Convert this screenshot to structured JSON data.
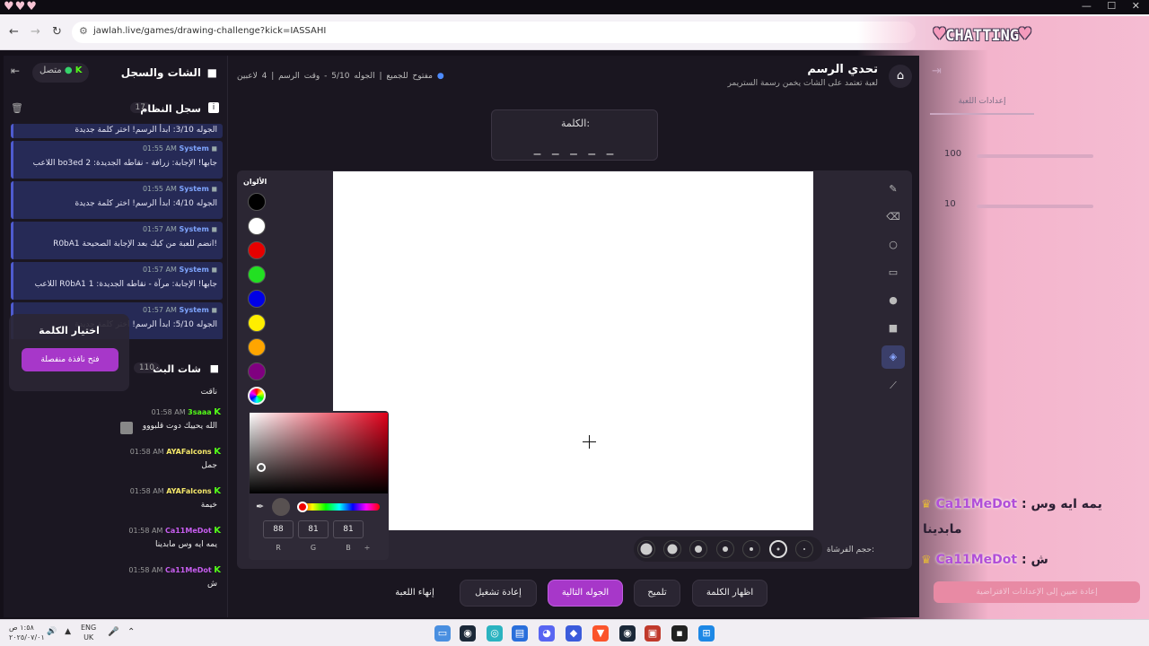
{
  "browser": {
    "url": "jawlah.live/games/drawing-challenge?kick=IASSAHI",
    "overlay_title": "CHATTING"
  },
  "left_panel": {
    "title": "الشات والسجل",
    "status": "متصل",
    "system_log": {
      "title": "سجل النظام",
      "count": "17",
      "entries": [
        {
          "time": "",
          "source": "",
          "text": "الجوله 3/10: ابدأ الرسم! اختر كلمة جديدة"
        },
        {
          "time": "01:55 AM",
          "source": "System",
          "text": "اللاعب bo3ed جابها! الإجابة: زرافة - نقاطه الجديدة: 2"
        },
        {
          "time": "01:55 AM",
          "source": "System",
          "text": "الجوله 4/10: ابدأ الرسم! اختر كلمة جديدة"
        },
        {
          "time": "01:57 AM",
          "source": "System",
          "text": "R0bA1 انضم للعبة من كيك بعد الإجابة الصحيحة!"
        },
        {
          "time": "01:57 AM",
          "source": "System",
          "text": "اللاعب R0bA1 جابها! الإجابة: مرآة - نقاطه الجديدة: 1"
        },
        {
          "time": "01:57 AM",
          "source": "System",
          "text": "الجوله 5/10: ابدأ الرسم! اختر كلمة جديدة"
        }
      ]
    },
    "stream_chat": {
      "title": "شات البث",
      "count": "110",
      "messages": [
        {
          "user": "",
          "time": "",
          "text": "ناقت",
          "color": "#ffffff"
        },
        {
          "user": "3saaa",
          "time": "01:58 AM",
          "text": "الله يحييك دوت قلبووو",
          "color": "#53fc18"
        },
        {
          "user": "AYAFalcons",
          "time": "01:58 AM",
          "text": "جمل",
          "color": "#f5e86a"
        },
        {
          "user": "AYAFalcons",
          "time": "01:58 AM",
          "text": "خيمة",
          "color": "#f5e86a"
        },
        {
          "user": "Ca11MeDot",
          "time": "01:58 AM",
          "text": "يمه ايه وس مابدينا",
          "color": "#c85ef0"
        },
        {
          "user": "Ca11MeDot",
          "time": "01:58 AM",
          "text": "ش",
          "color": "#c85ef0"
        }
      ]
    }
  },
  "word_popup": {
    "title": "اختيار الكلمة",
    "button": "فتح نافذة منفصلة"
  },
  "game": {
    "title": "تحدي الرسم",
    "subtitle": "لعبة تعتمد على الشات يخمن رسمة الستريمر",
    "players": "4 لاعبين",
    "round": "الجوله 5/10 - وقت الرسم",
    "access": "مفتوح للجميع",
    "word_label": "الكلمة:",
    "word_blanks": "_ _ _ _ _",
    "colors_label": "الألوان",
    "colors": [
      "#000000",
      "#ffffff",
      "#e60000",
      "#22e022",
      "#0000e6",
      "#ffee00",
      "#ffa500",
      "#800080"
    ],
    "picker": {
      "r": "88",
      "g": "81",
      "b": "81",
      "r_label": "R",
      "g_label": "G",
      "b_label": "B",
      "toggle": "÷"
    },
    "brush_label": "حجم الفرشاة:",
    "brush_selected_index": 5
  },
  "actions": {
    "reveal": "اظهار الكلمة",
    "hint": "تلميح",
    "next": "الجوله التالية",
    "restart": "إعادة تشغيل",
    "end": "إنهاء اللعبة"
  },
  "right_panel": {
    "tab": "إعدادات اللعبة",
    "value1": "100",
    "value2": "10",
    "reset": "إعادة تعيين إلى الإعدادات الافتراضية"
  },
  "overlay_chat": [
    {
      "user": "Ca11MeDot",
      "text": "يمه ايه وس",
      "text2": "مابدينا"
    },
    {
      "user": "Ca11MeDot",
      "text": "ش",
      "text2": ""
    }
  ],
  "taskbar": {
    "time": "١:٥٨ ص",
    "date": "٢٠٢٥/٠٧/٠١",
    "lang": "ENG",
    "region": "UK"
  }
}
